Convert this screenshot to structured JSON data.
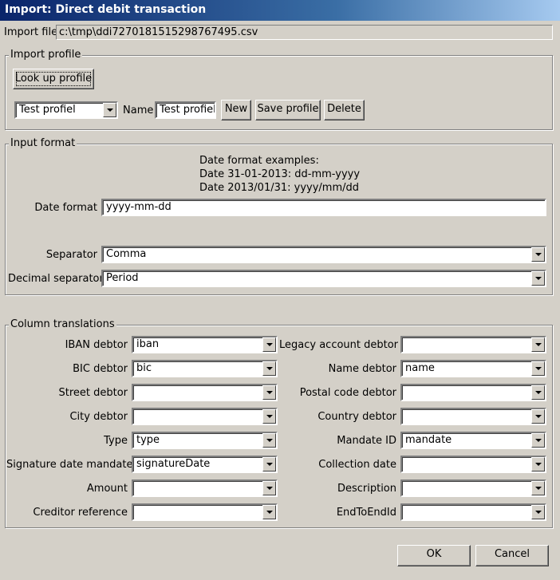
{
  "window": {
    "title": "Import: Direct debit transaction"
  },
  "import_file": {
    "label": "Import file",
    "value": "c:\\tmp\\ddi7270181515298767495.csv"
  },
  "import_profile": {
    "title": "Import profile",
    "lookup_label": "Look up profile",
    "profile_selected": "Test profiel",
    "name_label": "Name",
    "name_value": "Test profiel",
    "new_label": "New",
    "save_label": "Save profile",
    "delete_label": "Delete"
  },
  "input_format": {
    "title": "Input format",
    "examples_title": "Date format examples:",
    "example1": "Date 31-01-2013: dd-mm-yyyy",
    "example2": "Date 2013/01/31: yyyy/mm/dd",
    "date_format_label": "Date format",
    "date_format_value": "yyyy-mm-dd",
    "separator_label": "Separator",
    "separator_value": "Comma",
    "decimal_label": "Decimal separator",
    "decimal_value": "Period"
  },
  "columns": {
    "title": "Column translations",
    "left": [
      {
        "label": "IBAN debtor",
        "value": "iban"
      },
      {
        "label": "BIC debtor",
        "value": "bic"
      },
      {
        "label": "Street debtor",
        "value": ""
      },
      {
        "label": "City debtor",
        "value": ""
      },
      {
        "label": "Type",
        "value": "type"
      },
      {
        "label": "Signature date mandate",
        "value": "signatureDate"
      },
      {
        "label": "Amount",
        "value": ""
      },
      {
        "label": "Creditor reference",
        "value": ""
      }
    ],
    "right": [
      {
        "label": "Legacy account debtor",
        "value": ""
      },
      {
        "label": "Name debtor",
        "value": "name"
      },
      {
        "label": "Postal code debtor",
        "value": ""
      },
      {
        "label": "Country debtor",
        "value": ""
      },
      {
        "label": "Mandate ID",
        "value": "mandate"
      },
      {
        "label": "Collection date",
        "value": ""
      },
      {
        "label": "Description",
        "value": ""
      },
      {
        "label": "EndToEndId",
        "value": ""
      }
    ]
  },
  "footer": {
    "ok_label": "OK",
    "cancel_label": "Cancel"
  }
}
